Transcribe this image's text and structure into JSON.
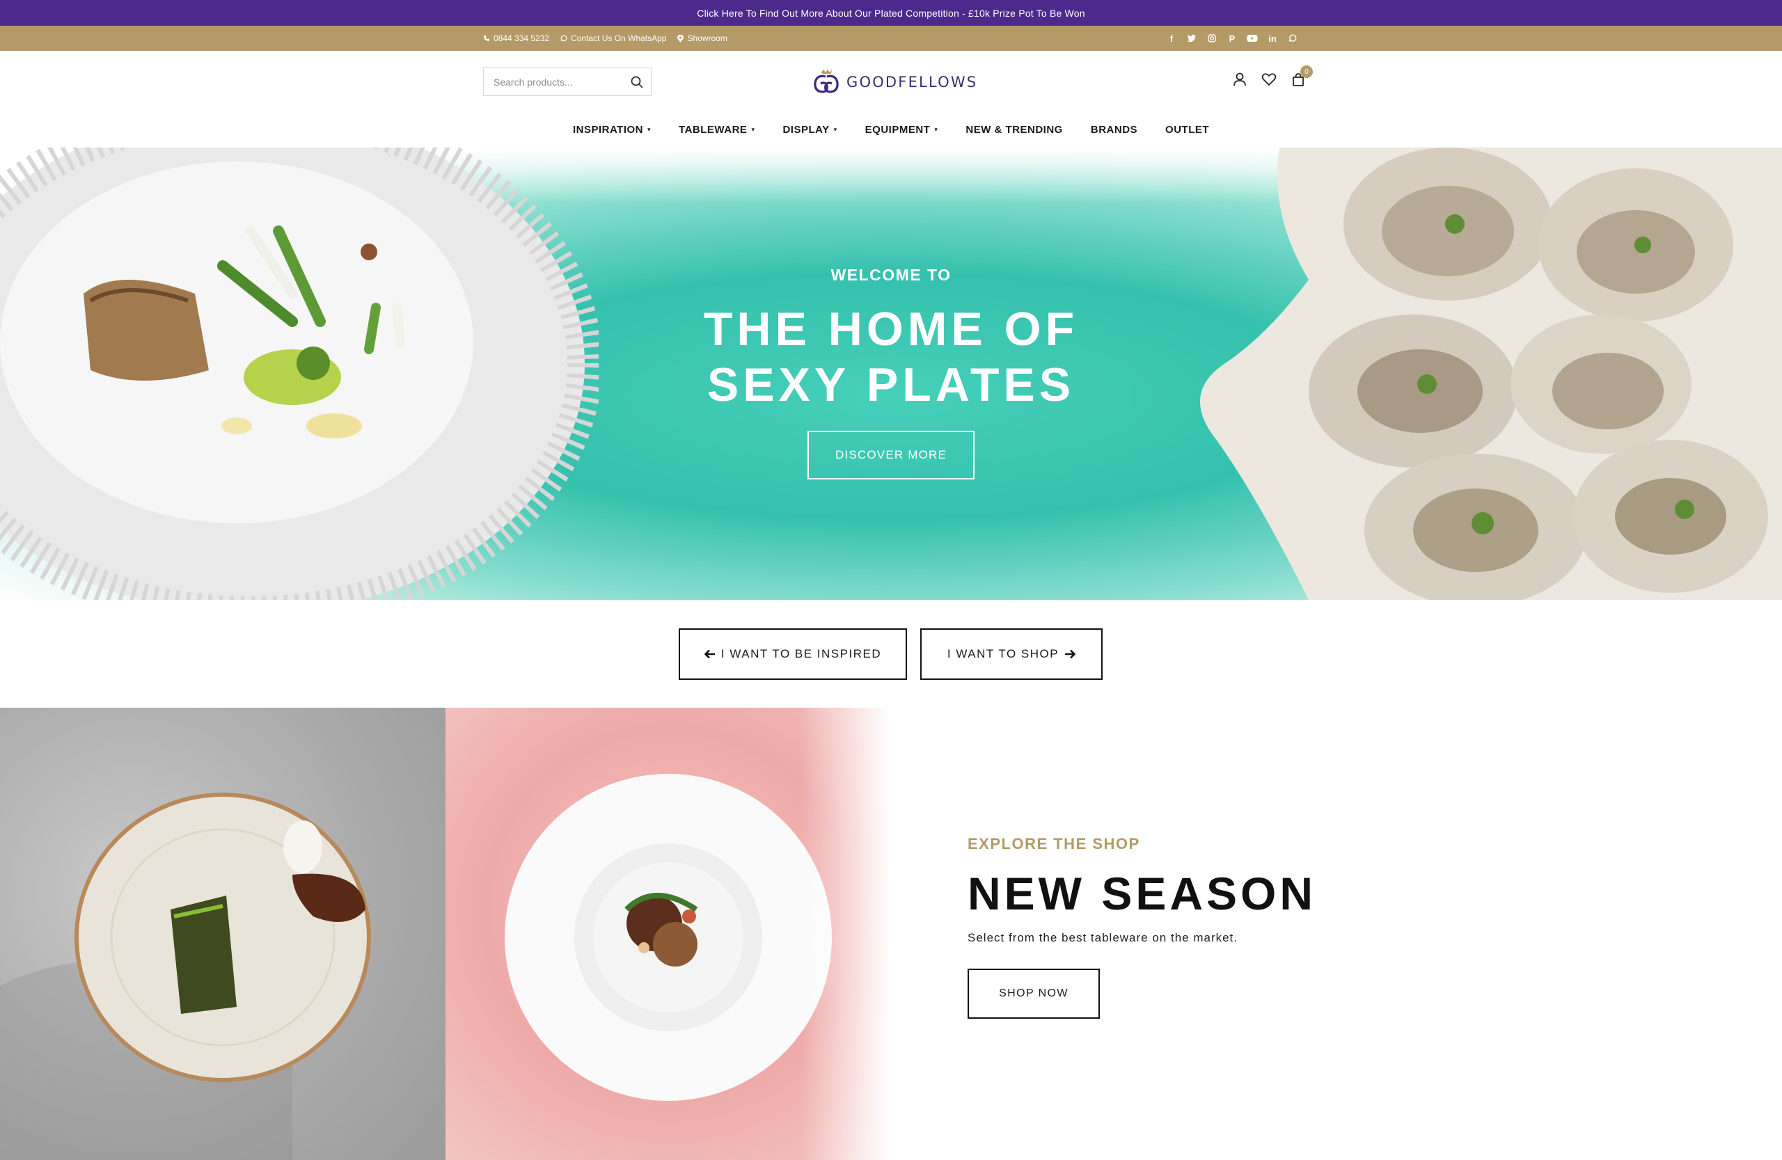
{
  "promo": {
    "text": "Click Here To Find Out More About Our Plated Competition - £10k Prize Pot To Be Won"
  },
  "utility": {
    "phone": "0844 334 5232",
    "whatsapp": "Contact Us On WhatsApp",
    "showroom": "Showroom",
    "social": [
      "facebook-icon",
      "twitter-icon",
      "instagram-icon",
      "pinterest-icon",
      "youtube-icon",
      "linkedin-icon",
      "whatsapp-icon"
    ]
  },
  "header": {
    "search_placeholder": "Search products...",
    "logo_text": "GOODFELLOWS",
    "cart_count": "0"
  },
  "nav": {
    "items": [
      "INSPIRATION",
      "TABLEWARE",
      "DISPLAY",
      "EQUIPMENT",
      "NEW & TRENDING",
      "BRANDS",
      "OUTLET"
    ]
  },
  "hero": {
    "welcome": "WELCOME TO",
    "title_line1": "THE HOME OF",
    "title_line2": "SEXY PLATES",
    "button": "DISCOVER MORE"
  },
  "cta": {
    "inspired": "I WANT TO BE INSPIRED",
    "shop": "I WANT TO SHOP"
  },
  "feature": {
    "kicker": "EXPLORE THE SHOP",
    "title": "NEW SEASON",
    "subtitle": "Select from the best tableware on the market.",
    "button": "SHOP NOW"
  },
  "colors": {
    "promo": "#4b2a8c",
    "utility": "#b39a67",
    "accent_gold": "#b39a67",
    "teal": "#35c1ad",
    "logo": "#3e2a77"
  }
}
